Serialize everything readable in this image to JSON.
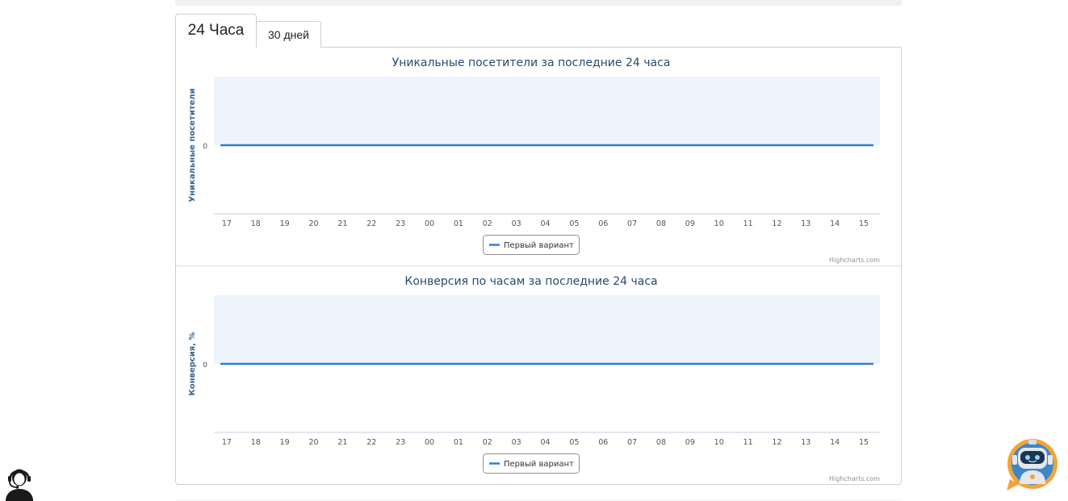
{
  "tabs": [
    {
      "label": "24 Часа",
      "active": true
    },
    {
      "label": "30 дней",
      "active": false
    }
  ],
  "chart_data": [
    {
      "type": "line",
      "title": "Уникальные посетители за последние 24 часа",
      "ylabel": "Уникальные посетители",
      "xlabel": "",
      "categories": [
        "17",
        "18",
        "19",
        "20",
        "21",
        "22",
        "23",
        "00",
        "01",
        "02",
        "03",
        "04",
        "05",
        "06",
        "07",
        "08",
        "09",
        "10",
        "11",
        "12",
        "13",
        "14",
        "15"
      ],
      "y_ticks": [
        "0"
      ],
      "series": [
        {
          "name": "Первый вариант",
          "color": "#2f7ed8",
          "values": [
            0,
            0,
            0,
            0,
            0,
            0,
            0,
            0,
            0,
            0,
            0,
            0,
            0,
            0,
            0,
            0,
            0,
            0,
            0,
            0,
            0,
            0,
            0
          ]
        }
      ],
      "plot_background": "#edf4fc",
      "legend": "bottom-center",
      "credits": "Highcharts.com"
    },
    {
      "type": "line",
      "title": "Конверсия по часам за последние 24 часа",
      "ylabel": "Конверсия, %",
      "xlabel": "",
      "categories": [
        "17",
        "18",
        "19",
        "20",
        "21",
        "22",
        "23",
        "00",
        "01",
        "02",
        "03",
        "04",
        "05",
        "06",
        "07",
        "08",
        "09",
        "10",
        "11",
        "12",
        "13",
        "14",
        "15"
      ],
      "y_ticks": [
        "0"
      ],
      "series": [
        {
          "name": "Первый вариант",
          "color": "#2f7ed8",
          "values": [
            0,
            0,
            0,
            0,
            0,
            0,
            0,
            0,
            0,
            0,
            0,
            0,
            0,
            0,
            0,
            0,
            0,
            0,
            0,
            0,
            0,
            0,
            0
          ]
        }
      ],
      "plot_background": "#edf4fc",
      "legend": "bottom-center",
      "credits": "Highcharts.com"
    }
  ],
  "icons": {
    "support": "support-agent-icon",
    "bot": "chat-bot-icon"
  },
  "colors": {
    "title": "#274b6d",
    "series": "#2f7ed8",
    "bot_ring": "#f0a030",
    "bot_face": "#2a6fb5"
  }
}
